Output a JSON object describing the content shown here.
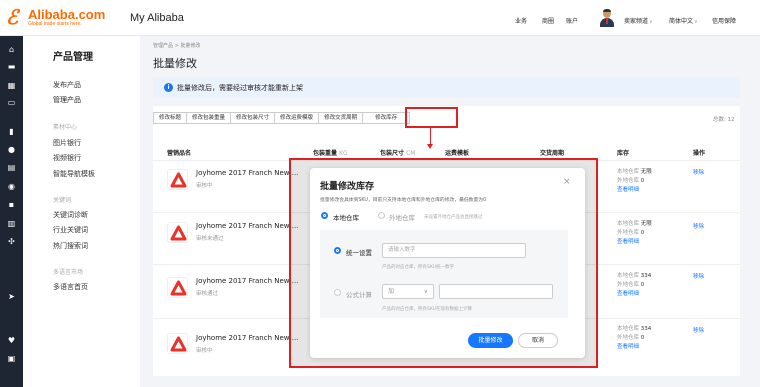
{
  "header": {
    "logo_word": "Alibaba.com",
    "logo_tagline": "Global trade starts here.",
    "app_title": "My Alibaba",
    "links": [
      "业务",
      "商圈",
      "账户"
    ],
    "seller_channel": "卖家频道",
    "language": "简体中文",
    "trust": "信用保障"
  },
  "rail_icons": [
    "home-icon",
    "box-icon",
    "grid-icon",
    "chat-icon",
    "chart-icon",
    "user-icon",
    "doc-icon",
    "globe-icon",
    "truck-icon",
    "bank-icon",
    "settings-icon",
    "send-icon",
    "heart-icon",
    "store-icon"
  ],
  "sidebar": {
    "title": "产品管理",
    "items": [
      {
        "label": "发布产品",
        "group": false
      },
      {
        "label": "管理产品",
        "group": false
      },
      {
        "label": "素材中心",
        "group": true
      },
      {
        "label": "图片银行",
        "group": false
      },
      {
        "label": "视频银行",
        "group": false
      },
      {
        "label": "智能导航模板",
        "group": false
      },
      {
        "label": "关键词",
        "group": true
      },
      {
        "label": "关键词诊断",
        "group": false
      },
      {
        "label": "行业关键词",
        "group": false
      },
      {
        "label": "热门搜索词",
        "group": false
      },
      {
        "label": "多语言市场",
        "group": true
      },
      {
        "label": "多语言首页",
        "group": false
      }
    ]
  },
  "breadcrumb": "管理产品 > 批量修改",
  "page_title": "批量修改",
  "notice": "批量修改后，需要经过审核才能重新上架",
  "tabs": [
    "修改标题",
    "修改包装重量",
    "修改包装尺寸",
    "修改运费模版",
    "修改交货周期",
    "修改库存"
  ],
  "total": "总数: 12",
  "columns": {
    "name": "营销品名",
    "weight": "包装重量",
    "weight_unit": "KG",
    "size": "包装尺寸",
    "size_unit": "CM",
    "freight": "运费模板",
    "delivery": "交货周期",
    "stock": "库存",
    "action": "操作"
  },
  "rows": [
    {
      "name": "Joyhome 2017 Franch New ...",
      "status": "审核中",
      "local_label": "本地仓库",
      "local_value": "无限",
      "overseas_label": "外地仓库",
      "overseas_value": "0",
      "details": "查看明细",
      "action": "移除"
    },
    {
      "name": "Joyhome 2017 Franch New ...",
      "status": "审核未通过",
      "local_label": "本地仓库",
      "local_value": "无限",
      "overseas_label": "外地仓库",
      "overseas_value": "0",
      "details": "查看明细",
      "action": "移除"
    },
    {
      "name": "Joyhome 2017 Franch New ...",
      "status": "审核通过",
      "local_label": "本地仓库",
      "local_value": "334",
      "overseas_label": "外地仓库",
      "overseas_value": "0",
      "details": "查看明细",
      "action": "移除"
    },
    {
      "name": "Joyhome 2017 Franch New ...",
      "status": "审核中",
      "local_label": "本地仓库",
      "local_value": "334",
      "overseas_label": "外地仓库",
      "overseas_value": "0",
      "details": "查看明细",
      "action": "移除"
    }
  ],
  "modal": {
    "title": "批量修改库存",
    "close": "×",
    "description": "批量修改会具体到SKU，目前只支持本地仓库和外地仓库的修改，最低数量为0",
    "local_option": "本地仓库",
    "overseas_option": "外地仓库",
    "overseas_hint": "未设置外地仓产品会直接跳过",
    "unified_option": "统一设置",
    "unified_placeholder": "请输入数字",
    "unified_hint": "产品的对应仓库，所有SKU统一数字",
    "formula_option": "公式计算",
    "formula_operator": "加",
    "formula_hint": "产品的对应仓库，所有SKU在现有数据上计算",
    "confirm": "批量修改",
    "cancel": "取消"
  },
  "colors": {
    "brand": "#ff6a00",
    "accent": "#1677ff",
    "annotation": "#e02020",
    "rail": "#1e2533"
  }
}
